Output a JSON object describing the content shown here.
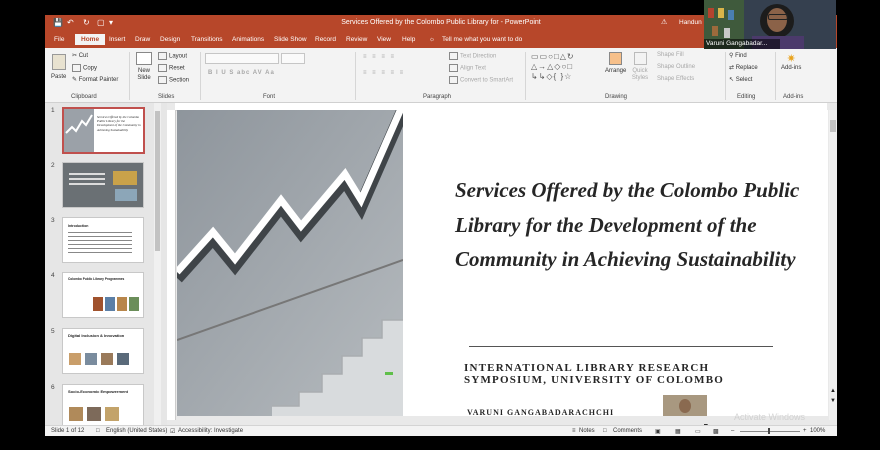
{
  "window": {
    "title": "Services Offered by the Colombo Public Library for  -  PowerPoint",
    "user_name": "Handun Pa"
  },
  "tabs": [
    {
      "label": "File"
    },
    {
      "label": "Home"
    },
    {
      "label": "Insert"
    },
    {
      "label": "Draw"
    },
    {
      "label": "Design"
    },
    {
      "label": "Transitions"
    },
    {
      "label": "Animations"
    },
    {
      "label": "Slide Show"
    },
    {
      "label": "Record"
    },
    {
      "label": "Review"
    },
    {
      "label": "View"
    },
    {
      "label": "Help"
    }
  ],
  "tell_me": "Tell me what you want to do",
  "ribbon": {
    "clipboard": {
      "group": "Clipboard",
      "paste": "Paste",
      "cut": "Cut",
      "copy": "Copy",
      "format_painter": "Format Painter"
    },
    "slides": {
      "group": "Slides",
      "new_slide": "New Slide",
      "layout": "Layout",
      "reset": "Reset",
      "section": "Section"
    },
    "font": {
      "group": "Font",
      "buttons": "B  I  U  S  abc  AV  Aa"
    },
    "paragraph": {
      "group": "Paragraph",
      "text_direction": "Text Direction",
      "align_text": "Align Text",
      "smartart": "Convert to SmartArt"
    },
    "drawing": {
      "group": "Drawing",
      "arrange": "Arrange",
      "quick_styles": "Quick Styles",
      "shape_fill": "Shape Fill",
      "shape_outline": "Shape Outline",
      "shape_effects": "Shape Effects"
    },
    "editing": {
      "group": "Editing",
      "find": "Find",
      "replace": "Replace",
      "select": "Select"
    },
    "addins": {
      "group": "Add-ins",
      "addins": "Add-ins"
    }
  },
  "thumbnails": [
    {
      "num": "1",
      "text": "Services Offered by the Colombo Public Library for the Development of the Community in Achieving Sustainability"
    },
    {
      "num": "2",
      "text": ""
    },
    {
      "num": "3",
      "text": "Introduction"
    },
    {
      "num": "4",
      "text": "Colombo Public Library Programmes"
    },
    {
      "num": "5",
      "text": "Digital Inclusion & Innovation"
    },
    {
      "num": "6",
      "text": "Socio-Economic Empowerment"
    }
  ],
  "slide": {
    "title": "Services Offered by the Colombo Public Library for the Development of the Community in Achieving Sustainability",
    "subtitle_line1": "INTERNATIONAL LIBRARY RESEARCH",
    "subtitle_line2": "SYMPOSIUM, UNIVERSITY OF COLOMBO",
    "author": "VARUNI GANGABADARACHCHI"
  },
  "status": {
    "slide_count": "Slide 1 of 12",
    "language": "English (United States)",
    "accessibility": "Accessibility: Investigate",
    "notes": "Notes",
    "comments": "Comments",
    "zoom": "100%"
  },
  "webcam": {
    "name": "Varuni Gangabadar..."
  },
  "watermark": "Activate Windows"
}
